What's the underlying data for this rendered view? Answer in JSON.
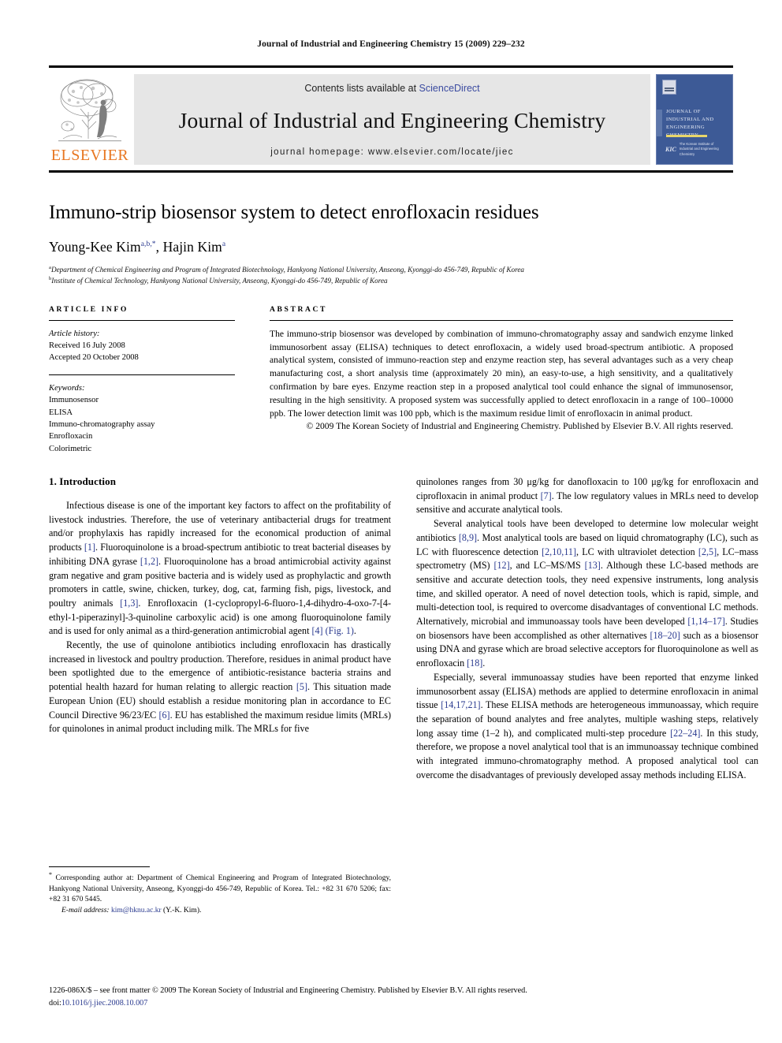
{
  "running_head": "Journal of Industrial and Engineering Chemistry 15 (2009) 229–232",
  "masthead": {
    "contents_prefix": "Contents lists available at ",
    "sciencedirect": "ScienceDirect",
    "journal_title": "Journal of Industrial and Engineering Chemistry",
    "homepage": "journal homepage: www.elsevier.com/locate/jiec",
    "publisher_logo_text": "ELSEVIER",
    "cover": {
      "title": "Journal of Industrial and Engineering Chemistry",
      "society_mark": "KIC",
      "society_text": "The Korean Institute of Industrial and Engineering Chemistry"
    },
    "accent_link_color": "#3b4ba0",
    "elsevier_orange": "#E87722",
    "cover_blue": "#3d5a96"
  },
  "article": {
    "title": "Immuno-strip biosensor system to detect enrofloxacin residues",
    "authors": [
      {
        "name": "Young-Kee Kim",
        "marks": "a,b,*"
      },
      {
        "name": "Hajin Kim",
        "marks": "a"
      }
    ],
    "authors_line": "Young-Kee Kim",
    "author2": "Hajin Kim",
    "affiliations": [
      {
        "mark": "a",
        "text": "Department of Chemical Engineering and Program of Integrated Biotechnology, Hankyong National University, Anseong, Kyonggi-do 456-749, Republic of Korea"
      },
      {
        "mark": "b",
        "text": "Institute of Chemical Technology, Hankyong National University, Anseong, Kyonggi-do 456-749, Republic of Korea"
      }
    ]
  },
  "article_info": {
    "heading": "ARTICLE INFO",
    "history_label": "Article history:",
    "history": [
      "Received 16 July 2008",
      "Accepted 20 October 2008"
    ],
    "keywords_label": "Keywords:",
    "keywords": [
      "Immunosensor",
      "ELISA",
      "Immuno-chromatography assay",
      "Enrofloxacin",
      "Colorimetric"
    ]
  },
  "abstract": {
    "heading": "ABSTRACT",
    "text": "The immuno-strip biosensor was developed by combination of immuno-chromatography assay and sandwich enzyme linked immunosorbent assay (ELISA) techniques to detect enrofloxacin, a widely used broad-spectrum antibiotic. A proposed analytical system, consisted of immuno-reaction step and enzyme reaction step, has several advantages such as a very cheap manufacturing cost, a short analysis time (approximately 20 min), an easy-to-use, a high sensitivity, and a qualitatively confirmation by bare eyes. Enzyme reaction step in a proposed analytical tool could enhance the signal of immunosensor, resulting in the high sensitivity. A proposed system was successfully applied to detect enrofloxacin in a range of 100–10000 ppb. The lower detection limit was 100 ppb, which is the maximum residue limit of enrofloxacin in animal product.",
    "copyright": "© 2009 The Korean Society of Industrial and Engineering Chemistry. Published by Elsevier B.V. All rights reserved."
  },
  "body": {
    "section_title": "1. Introduction",
    "left_paragraphs": [
      "Infectious disease is one of the important key factors to affect on the profitability of livestock industries. Therefore, the use of veterinary antibacterial drugs for treatment and/or prophylaxis has rapidly increased for the economical production of animal products [1]. Fluoroquinolone is a broad-spectrum antibiotic to treat bacterial diseases by inhibiting DNA gyrase [1,2]. Fluoroquinolone has a broad antimicrobial activity against gram negative and gram positive bacteria and is widely used as prophylactic and growth promoters in cattle, swine, chicken, turkey, dog, cat, farming fish, pigs, livestock, and poultry animals [1,3]. Enrofloxacin (1-cyclopropyl-6-fluoro-1,4-dihydro-4-oxo-7-[4-ethyl-1-piperazinyl]-3-quinoline carboxylic acid) is one among fluoroquinolone family and is used for only animal as a third-generation antimicrobial agent [4] (Fig. 1).",
      "Recently, the use of quinolone antibiotics including enrofloxacin has drastically increased in livestock and poultry production. Therefore, residues in animal product have been spotlighted due to the emergence of antibiotic-resistance bacteria strains and potential health hazard for human relating to allergic reaction [5]. This situation made European Union (EU) should establish a residue monitoring plan in accordance to EC Council Directive 96/23/EC [6]. EU has established the maximum residue limits (MRLs) for quinolones in animal product including milk. The MRLs for five"
    ],
    "right_paragraphs": [
      "quinolones ranges from 30 μg/kg for danofloxacin to 100 μg/kg for enrofloxacin and ciprofloxacin in animal product [7]. The low regulatory values in MRLs need to develop sensitive and accurate analytical tools.",
      "Several analytical tools have been developed to determine low molecular weight antibiotics [8,9]. Most analytical tools are based on liquid chromatography (LC), such as LC with fluorescence detection [2,10,11], LC with ultraviolet detection [2,5], LC–mass spectrometry (MS) [12], and LC–MS/MS [13]. Although these LC-based methods are sensitive and accurate detection tools, they need expensive instruments, long analysis time, and skilled operator. A need of novel detection tools, which is rapid, simple, and multi-detection tool, is required to overcome disadvantages of conventional LC methods. Alternatively, microbial and immunoassay tools have been developed [1,14–17]. Studies on biosensors have been accomplished as other alternatives [18–20] such as a biosensor using DNA and gyrase which are broad selective acceptors for fluoroquinolone as well as enrofloxacin [18].",
      "Especially, several immunoassay studies have been reported that enzyme linked immunosorbent assay (ELISA) methods are applied to determine enrofloxacin in animal tissue [14,17,21]. These ELISA methods are heterogeneous immunoassay, which require the separation of bound analytes and free analytes, multiple washing steps, relatively long assay time (1–2 h), and complicated multi-step procedure [22–24]. In this study, therefore, we propose a novel analytical tool that is an immunoassay technique combined with integrated immuno-chromatography method. A proposed analytical tool can overcome the disadvantages of previously developed assay methods including ELISA."
    ]
  },
  "footnote": {
    "corresponding": "* Corresponding author at: Department of Chemical Engineering and Program of Integrated Biotechnology, Hankyong National University, Anseong, Kyonggi-do 456-749, Republic of Korea. Tel.: +82 31 670 5206; fax: +82 31 670 5445.",
    "email_label": "E-mail address:",
    "email": "kim@hknu.ac.kr",
    "email_owner": "(Y.-K. Kim)."
  },
  "bottom_matter": {
    "front_matter": "1226-086X/$ – see front matter © 2009 The Korean Society of Industrial and Engineering Chemistry. Published by Elsevier B.V. All rights reserved.",
    "doi_label": "doi:",
    "doi": "10.1016/j.jiec.2008.10.007"
  }
}
